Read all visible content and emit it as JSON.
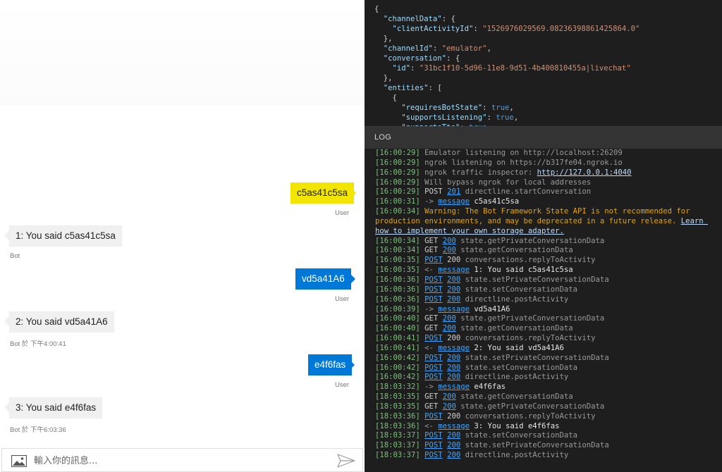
{
  "chat": {
    "messages": [
      {
        "from": "user",
        "text": "c5as41c5sa",
        "meta": "User",
        "color": "#f2e600"
      },
      {
        "from": "bot",
        "text": "1: You said c5as41c5sa",
        "meta": "Bot"
      },
      {
        "from": "user",
        "text": "vd5a41A6",
        "meta": "User",
        "color": "#0078d7"
      },
      {
        "from": "bot",
        "text": "2: You said vd5a41A6",
        "meta": "Bot 於 下午4:00:41"
      },
      {
        "from": "user",
        "text": "e4f6fas",
        "meta": "User",
        "color": "#0078d7"
      },
      {
        "from": "bot",
        "text": "3: You said e4f6fas",
        "meta": "Bot 於 下午6:03:36"
      }
    ],
    "composer": {
      "placeholder": "輸入你的訊息...",
      "attach_icon": "image-icon",
      "send_icon": "send-arrow-icon"
    }
  },
  "inspector": {
    "json_lines": [
      "{",
      "  \"channelData\": {",
      "    \"clientActivityId\": \"1526976029569.08236398861425864.0\"",
      "  },",
      "  \"channelId\": \"emulator\",",
      "  \"conversation\": {",
      "    \"id\": \"31bc1f10-5d96-11e8-9d51-4b400810455a|livechat\"",
      "  },",
      "  \"entities\": [",
      "    {",
      "      \"requiresBotState\": true,",
      "      \"supportsListening\": true,",
      "      \"supportsTts\": true"
    ],
    "log_title": "LOG",
    "log": [
      {
        "ts": "[16:00:29]",
        "parts": [
          {
            "c": "tx",
            "t": "Emulator listening on http://localhost:26209"
          }
        ]
      },
      {
        "ts": "[16:00:29]",
        "parts": [
          {
            "c": "tx",
            "t": "ngrok listening on https://b317fe04.ngrok.io"
          }
        ]
      },
      {
        "ts": "[16:00:29]",
        "parts": [
          {
            "c": "tx",
            "t": "ngrok traffic inspector: "
          },
          {
            "c": "lnkw",
            "t": "http://127.0.0.1:4040"
          }
        ]
      },
      {
        "ts": "[16:00:29]",
        "parts": [
          {
            "c": "tx",
            "t": "Will bypass ngrok for local addresses"
          }
        ]
      },
      {
        "ts": "[16:00:29]",
        "parts": [
          {
            "c": "verb",
            "t": "POST "
          },
          {
            "c": "lnk",
            "t": "201"
          },
          {
            "c": "tx",
            "t": " directline.startConversation"
          }
        ]
      },
      {
        "ts": "[16:00:31]",
        "parts": [
          {
            "c": "arrow",
            "t": "-> "
          },
          {
            "c": "lnk",
            "t": "message"
          },
          {
            "c": "msgtxt",
            "t": " c5as41c5sa"
          }
        ]
      },
      {
        "ts": "[16:00:34]",
        "wrap": true,
        "parts": [
          {
            "c": "wrn",
            "t": "Warning: The Bot Framework State API is not recommended for production environments, and may be deprecated in a future release. "
          },
          {
            "c": "lnkw",
            "t": "Learn how to implement your own storage adapter."
          }
        ]
      },
      {
        "ts": "[16:00:34]",
        "parts": [
          {
            "c": "verb",
            "t": "GET "
          },
          {
            "c": "lnk",
            "t": "200"
          },
          {
            "c": "tx",
            "t": " state.getPrivateConversationData"
          }
        ]
      },
      {
        "ts": "[16:00:34]",
        "parts": [
          {
            "c": "verb",
            "t": "GET "
          },
          {
            "c": "lnk",
            "t": "200"
          },
          {
            "c": "tx",
            "t": " state.getConversationData"
          }
        ]
      },
      {
        "ts": "[16:00:35]",
        "parts": [
          {
            "c": "lnk",
            "t": "POST"
          },
          {
            "c": "num",
            "t": " 200"
          },
          {
            "c": "tx",
            "t": " conversations.replyToActivity"
          }
        ]
      },
      {
        "ts": "[16:00:35]",
        "parts": [
          {
            "c": "arrow",
            "t": "<- "
          },
          {
            "c": "lnk",
            "t": "message"
          },
          {
            "c": "msgtxt",
            "t": " 1: You said c5as41c5sa"
          }
        ]
      },
      {
        "ts": "[16:00:36]",
        "parts": [
          {
            "c": "lnk",
            "t": "POST"
          },
          {
            "c": "tx",
            "t": " "
          },
          {
            "c": "lnk",
            "t": "200"
          },
          {
            "c": "tx",
            "t": " state.setPrivateConversationData"
          }
        ]
      },
      {
        "ts": "[16:00:36]",
        "parts": [
          {
            "c": "lnk",
            "t": "POST"
          },
          {
            "c": "tx",
            "t": " "
          },
          {
            "c": "lnk",
            "t": "200"
          },
          {
            "c": "tx",
            "t": " state.setConversationData"
          }
        ]
      },
      {
        "ts": "[16:00:36]",
        "parts": [
          {
            "c": "lnk",
            "t": "POST"
          },
          {
            "c": "tx",
            "t": " "
          },
          {
            "c": "lnk",
            "t": "200"
          },
          {
            "c": "tx",
            "t": " directline.postActivity"
          }
        ]
      },
      {
        "ts": "[16:00:39]",
        "parts": [
          {
            "c": "arrow",
            "t": "-> "
          },
          {
            "c": "lnk",
            "t": "message"
          },
          {
            "c": "msgtxt",
            "t": " vd5a41A6"
          }
        ]
      },
      {
        "ts": "[16:00:40]",
        "parts": [
          {
            "c": "verb",
            "t": "GET "
          },
          {
            "c": "lnk",
            "t": "200"
          },
          {
            "c": "tx",
            "t": " state.getPrivateConversationData"
          }
        ]
      },
      {
        "ts": "[16:00:40]",
        "parts": [
          {
            "c": "verb",
            "t": "GET "
          },
          {
            "c": "lnk",
            "t": "200"
          },
          {
            "c": "tx",
            "t": " state.getConversationData"
          }
        ]
      },
      {
        "ts": "[16:00:41]",
        "parts": [
          {
            "c": "lnk",
            "t": "POST"
          },
          {
            "c": "num",
            "t": " 200"
          },
          {
            "c": "tx",
            "t": " conversations.replyToActivity"
          }
        ]
      },
      {
        "ts": "[16:00:41]",
        "parts": [
          {
            "c": "arrow",
            "t": "<- "
          },
          {
            "c": "lnk",
            "t": "message"
          },
          {
            "c": "msgtxt",
            "t": " 2: You said vd5a41A6"
          }
        ]
      },
      {
        "ts": "[16:00:42]",
        "parts": [
          {
            "c": "lnk",
            "t": "POST"
          },
          {
            "c": "tx",
            "t": " "
          },
          {
            "c": "lnk",
            "t": "200"
          },
          {
            "c": "tx",
            "t": " state.setPrivateConversationData"
          }
        ]
      },
      {
        "ts": "[16:00:42]",
        "parts": [
          {
            "c": "lnk",
            "t": "POST"
          },
          {
            "c": "tx",
            "t": " "
          },
          {
            "c": "lnk",
            "t": "200"
          },
          {
            "c": "tx",
            "t": " state.setConversationData"
          }
        ]
      },
      {
        "ts": "[16:00:42]",
        "parts": [
          {
            "c": "lnk",
            "t": "POST"
          },
          {
            "c": "tx",
            "t": " "
          },
          {
            "c": "lnk",
            "t": "200"
          },
          {
            "c": "tx",
            "t": " directline.postActivity"
          }
        ]
      },
      {
        "ts": "[18:03:32]",
        "parts": [
          {
            "c": "arrow",
            "t": "-> "
          },
          {
            "c": "lnk",
            "t": "message"
          },
          {
            "c": "msgtxt",
            "t": " e4f6fas"
          }
        ]
      },
      {
        "ts": "[18:03:35]",
        "parts": [
          {
            "c": "verb",
            "t": "GET "
          },
          {
            "c": "lnk",
            "t": "200"
          },
          {
            "c": "tx",
            "t": " state.getConversationData"
          }
        ]
      },
      {
        "ts": "[18:03:35]",
        "parts": [
          {
            "c": "verb",
            "t": "GET "
          },
          {
            "c": "lnk",
            "t": "200"
          },
          {
            "c": "tx",
            "t": " state.getPrivateConversationData"
          }
        ]
      },
      {
        "ts": "[18:03:36]",
        "parts": [
          {
            "c": "lnk",
            "t": "POST"
          },
          {
            "c": "num",
            "t": " 200"
          },
          {
            "c": "tx",
            "t": " conversations.replyToActivity"
          }
        ]
      },
      {
        "ts": "[18:03:36]",
        "parts": [
          {
            "c": "arrow",
            "t": "<- "
          },
          {
            "c": "lnk",
            "t": "message"
          },
          {
            "c": "msgtxt",
            "t": " 3: You said e4f6fas"
          }
        ]
      },
      {
        "ts": "[18:03:37]",
        "parts": [
          {
            "c": "lnk",
            "t": "POST"
          },
          {
            "c": "tx",
            "t": " "
          },
          {
            "c": "lnk",
            "t": "200"
          },
          {
            "c": "tx",
            "t": " state.setConversationData"
          }
        ]
      },
      {
        "ts": "[18:03:37]",
        "parts": [
          {
            "c": "lnk",
            "t": "POST"
          },
          {
            "c": "tx",
            "t": " "
          },
          {
            "c": "lnk",
            "t": "200"
          },
          {
            "c": "tx",
            "t": " state.setPrivateConversationData"
          }
        ]
      },
      {
        "ts": "[18:03:37]",
        "parts": [
          {
            "c": "lnk",
            "t": "POST"
          },
          {
            "c": "tx",
            "t": " "
          },
          {
            "c": "lnk",
            "t": "200"
          },
          {
            "c": "tx",
            "t": " directline.postActivity"
          }
        ]
      }
    ]
  }
}
